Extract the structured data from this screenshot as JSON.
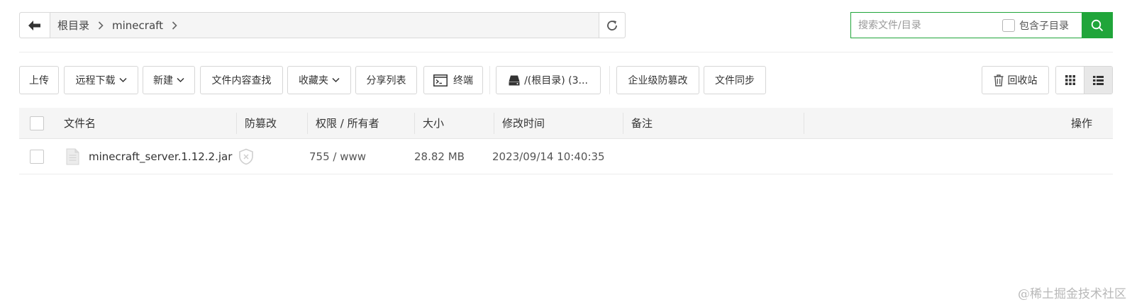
{
  "breadcrumb": {
    "items": [
      "根目录",
      "minecraft"
    ]
  },
  "search": {
    "placeholder": "搜索文件/目录",
    "include_subdir_label": "包含子目录"
  },
  "toolbar": {
    "upload": "上传",
    "remote_download": "远程下载",
    "new": "新建",
    "content_search": "文件内容查找",
    "favorites": "收藏夹",
    "share_list": "分享列表",
    "terminal": "终端",
    "disk": "/(根目录) (3...",
    "tamper_proof": "企业级防篡改",
    "file_sync": "文件同步",
    "recycle_bin": "回收站"
  },
  "table": {
    "headers": {
      "name": "文件名",
      "tamper": "防篡改",
      "perm": "权限 / 所有者",
      "size": "大小",
      "mtime": "修改时间",
      "note": "备注",
      "ops": "操作"
    },
    "rows": [
      {
        "name": "minecraft_server.1.12.2.jar",
        "perm": "755 / www",
        "size": "28.82 MB",
        "mtime": "2023/09/14 10:40:35",
        "note": ""
      }
    ]
  },
  "watermark": "@稀土掘金技术社区",
  "colors": {
    "accent": "#20a53a"
  }
}
